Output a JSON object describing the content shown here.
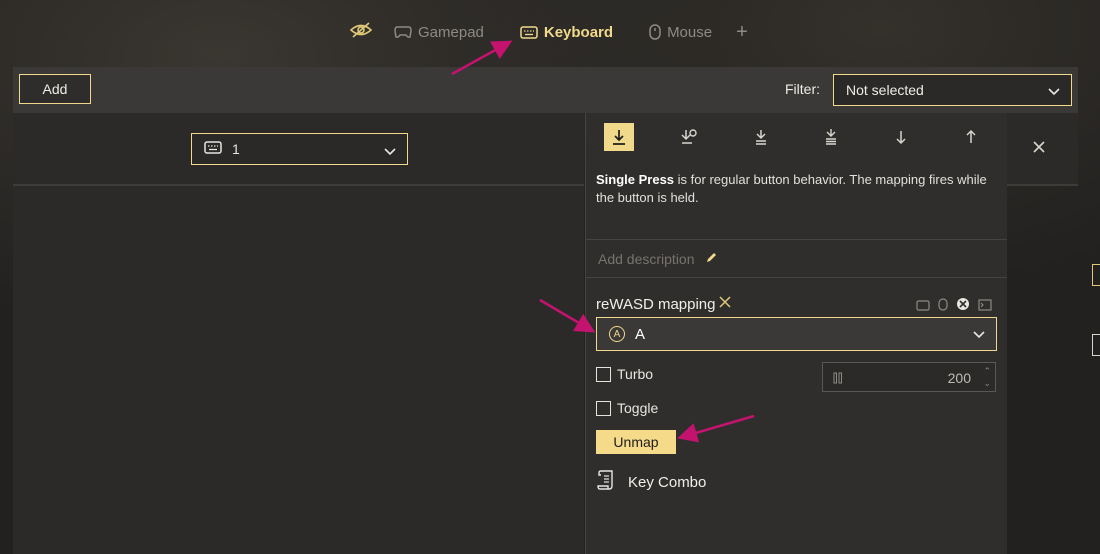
{
  "device_tabs": [
    {
      "label": "Gamepad",
      "icon": "gamepad-icon",
      "active": false
    },
    {
      "label": "Keyboard",
      "icon": "keyboard-icon",
      "active": true
    },
    {
      "label": "Mouse",
      "icon": "mouse-icon",
      "active": false
    }
  ],
  "toolbar": {
    "add_label": "Add",
    "filter_label": "Filter:",
    "filter_value": "Not selected"
  },
  "layer_select": {
    "value": "1",
    "icon": "keyboard-icon"
  },
  "press_types": [
    {
      "icon": "single-press-icon",
      "active": true
    },
    {
      "icon": "long-press-icon",
      "active": false
    },
    {
      "icon": "double-press-icon",
      "active": false
    },
    {
      "icon": "triple-press-icon",
      "active": false
    },
    {
      "icon": "start-press-icon",
      "active": false
    },
    {
      "icon": "release-icon",
      "active": false
    }
  ],
  "description": {
    "bold": "Single Press",
    "text": " is for regular button behavior. The mapping fires while the button is held."
  },
  "add_description_placeholder": "Add description",
  "mapping": {
    "title": "reWASD mapping",
    "value": "A",
    "badge": "A"
  },
  "options": {
    "turbo_label": "Turbo",
    "turbo_value": "200",
    "toggle_label": "Toggle"
  },
  "unmap_label": "Unmap",
  "key_combo_label": "Key Combo",
  "colors": {
    "accent": "#f0d98a",
    "annotation_arrow": "#c4136f"
  }
}
